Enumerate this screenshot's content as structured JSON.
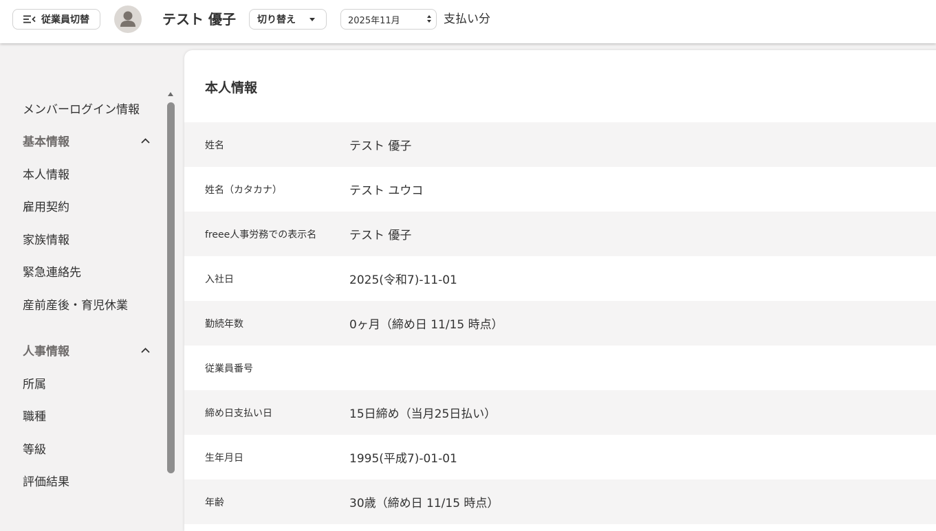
{
  "header": {
    "switch_label": "従業員切替",
    "employee_name": "テスト 優子",
    "toggle_label": "切り替え",
    "month_value": "2025年11月",
    "pay_label": "支払い分"
  },
  "sidebar": {
    "login_info": "メンバーログイン情報",
    "basic_section": "基本情報",
    "basic_items": [
      "本人情報",
      "雇用契約",
      "家族情報",
      "緊急連絡先",
      "産前産後・育児休業"
    ],
    "hr_section": "人事情報",
    "hr_items": [
      "所属",
      "職種",
      "等級",
      "評価結果"
    ]
  },
  "main": {
    "title": "本人情報",
    "rows": [
      {
        "label": "姓名",
        "value": "テスト 優子"
      },
      {
        "label": "姓名（カタカナ）",
        "value": "テスト ユウコ"
      },
      {
        "label": "freee人事労務での表示名",
        "value": "テスト 優子"
      },
      {
        "label": "入社日",
        "value": "2025(令和7)-11-01"
      },
      {
        "label": "勤続年数",
        "value": "0ヶ月（締め日 11/15 時点）"
      },
      {
        "label": "従業員番号",
        "value": ""
      },
      {
        "label": "締め日支払い日",
        "value": "15日締め（当月25日払い）"
      },
      {
        "label": "生年月日",
        "value": "1995(平成7)-01-01"
      },
      {
        "label": "年齢",
        "value": "30歳（締め日 11/15 時点）"
      }
    ]
  },
  "icons": {
    "switch": "menu-collapse-icon",
    "avatar": "user-avatar-icon",
    "toggle_caret": "caret-down-icon",
    "section_chevron": "chevron-up-icon"
  }
}
